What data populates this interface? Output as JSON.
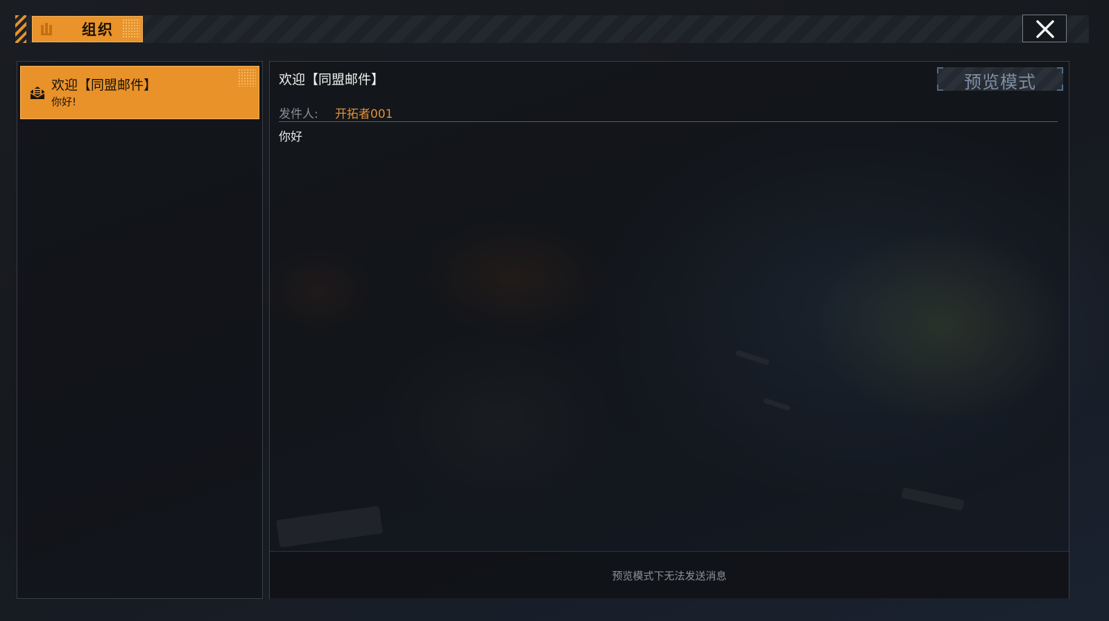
{
  "header": {
    "tab_label": "组织",
    "tab_icon": "organization-icon",
    "close_icon": "close-icon"
  },
  "mail_list": {
    "items": [
      {
        "title": "欢迎【同盟邮件】",
        "preview": "你好!",
        "icon": "mail-icon",
        "selected": true
      }
    ]
  },
  "message": {
    "title": "欢迎【同盟邮件】",
    "mode_badge": "预览模式",
    "sender_label": "发件人:",
    "sender_name": "开拓者001",
    "body": "你好",
    "footer_notice": "预览模式下无法发送消息"
  },
  "colors": {
    "accent": "#e9932a",
    "sender": "#e09036",
    "badge_text": "#7e8ea2"
  }
}
